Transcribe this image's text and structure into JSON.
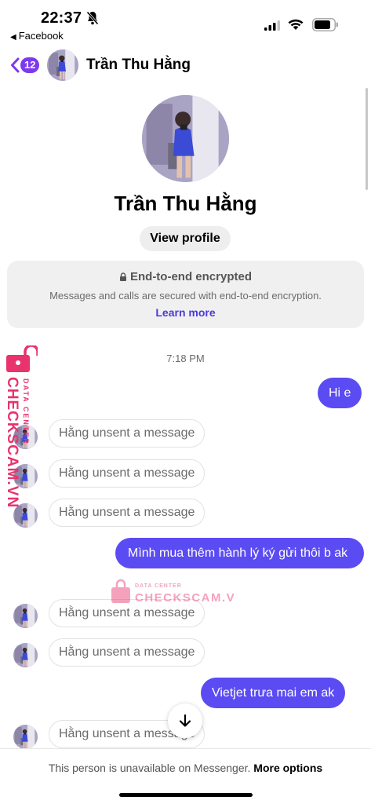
{
  "status_bar": {
    "time": "22:37",
    "back_app": "Facebook",
    "icons": [
      "bell-slash-icon",
      "signal-icon",
      "wifi-icon",
      "battery-icon"
    ]
  },
  "header": {
    "back_badge": "12",
    "name": "Trần Thu Hằng",
    "icons": [
      "chevron-left-icon"
    ]
  },
  "profile": {
    "name": "Trần Thu Hằng",
    "view_profile_label": "View profile"
  },
  "encryption": {
    "title": "End-to-end encrypted",
    "text": "Messages and calls are secured with end-to-end encryption.",
    "link": "Learn more"
  },
  "messages": {
    "timestamp": "7:18 PM",
    "items": [
      {
        "type": "outgoing",
        "text": "Hi e"
      },
      {
        "type": "unsent",
        "text": "Hằng unsent a message"
      },
      {
        "type": "unsent",
        "text": "Hằng unsent a message"
      },
      {
        "type": "unsent",
        "text": "Hằng unsent a message"
      },
      {
        "type": "outgoing",
        "text": "Mình mua thêm hành lý ký gửi thôi b ak"
      },
      {
        "type": "unsent",
        "text": "Hằng unsent a message"
      },
      {
        "type": "unsent",
        "text": "Hằng unsent a message"
      },
      {
        "type": "outgoing",
        "text": "Vietjet trưa mai em ak"
      },
      {
        "type": "unsent",
        "text": "Hằng unsent a message"
      }
    ]
  },
  "watermark": {
    "vertical_brand": "CHECKSCAM.VN",
    "vertical_tag": "DATA CENTER",
    "center_brand": "CHECKSCAM.VN",
    "center_tag": "DATA CENTER"
  },
  "footer": {
    "text": "This person is unavailable on Messenger.",
    "link": "More options"
  },
  "colors": {
    "outgoing_bubble": "#5b4bf2",
    "link": "#4b3bd6",
    "badge": "#7c3aed",
    "watermark": "#e8336d"
  }
}
